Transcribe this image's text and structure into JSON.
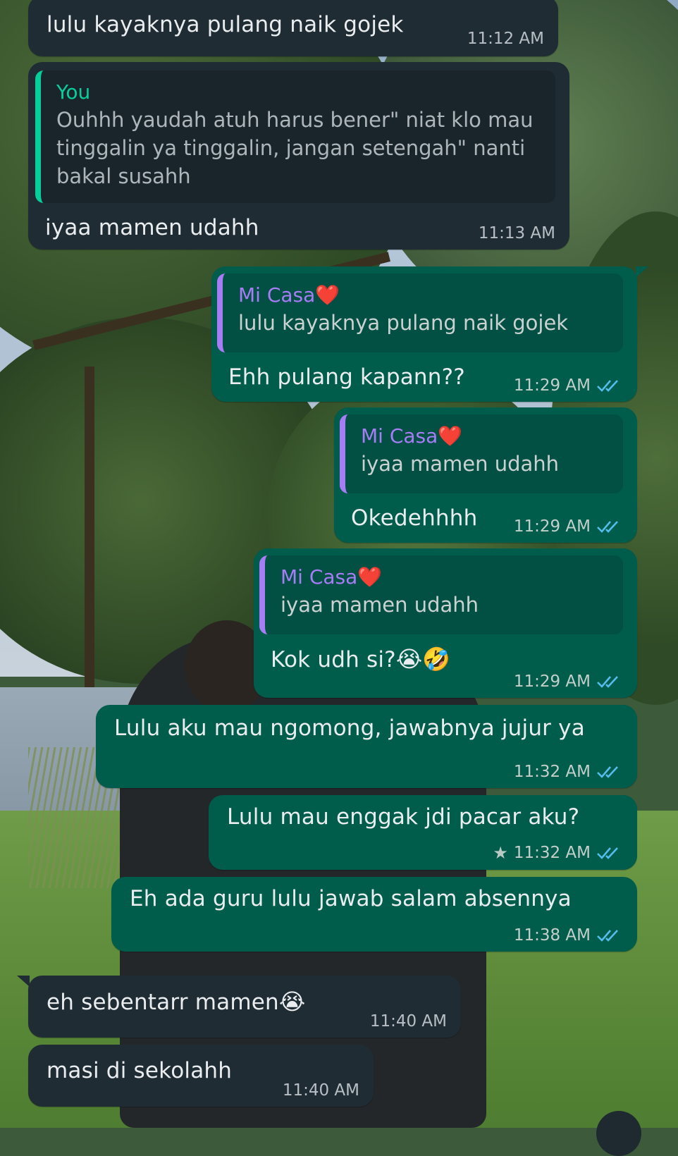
{
  "chat": {
    "contact_name": "Mi Casa❤️",
    "messages": [
      {
        "id": "m1",
        "direction": "incoming",
        "text": "lulu kayaknya pulang naik gojek",
        "time": "11:12 AM"
      },
      {
        "id": "m2",
        "direction": "incoming",
        "reply_to": {
          "author": "You",
          "text": "Ouhhh yaudah atuh harus bener\" niat klo mau tinggalin ya tinggalin, jangan setengah\" nanti bakal susahh"
        },
        "text": "iyaa mamen udahh",
        "time": "11:13 AM"
      },
      {
        "id": "m3",
        "direction": "outgoing",
        "reply_to": {
          "author": "Mi Casa",
          "text": "lulu kayaknya pulang naik gojek"
        },
        "text": "Ehh pulang kapann??",
        "time": "11:29 AM",
        "status": "read"
      },
      {
        "id": "m4",
        "direction": "outgoing",
        "reply_to": {
          "author": "Mi Casa",
          "text": "iyaa mamen udahh"
        },
        "text": "Okedehhhh",
        "time": "11:29 AM",
        "status": "read"
      },
      {
        "id": "m5",
        "direction": "outgoing",
        "reply_to": {
          "author": "Mi Casa",
          "text": "iyaa mamen udahh"
        },
        "text": "Kok udh si?",
        "emojis": "😭🤣",
        "time": "11:29 AM",
        "status": "read"
      },
      {
        "id": "m6",
        "direction": "outgoing",
        "text": "Lulu aku mau ngomong, jawabnya jujur ya",
        "time": "11:32 AM",
        "status": "read"
      },
      {
        "id": "m7",
        "direction": "outgoing",
        "text": "Lulu mau enggak jdi pacar aku?",
        "time": "11:32 AM",
        "status": "read",
        "starred": true
      },
      {
        "id": "m8",
        "direction": "outgoing",
        "text": "Eh ada guru lulu jawab salam absennya",
        "time": "11:38 AM",
        "status": "read"
      },
      {
        "id": "m9",
        "direction": "incoming",
        "text": "eh sebentarr mamen",
        "emojis": "😭",
        "time": "11:40 AM"
      },
      {
        "id": "m10",
        "direction": "incoming",
        "text": "masi di sekolahh",
        "time": "11:40 AM"
      }
    ],
    "heart": "❤️"
  },
  "colors": {
    "incoming_bubble": "#202c33",
    "outgoing_bubble": "#005c4b",
    "read_ticks": "#53bdeb",
    "quote_author_self": "#06cf9c",
    "quote_author_contact": "#a67df5"
  },
  "icons": {
    "read_status": "double-check-icon",
    "star": "star-icon",
    "scroll_down": "chevron-down-icon"
  }
}
